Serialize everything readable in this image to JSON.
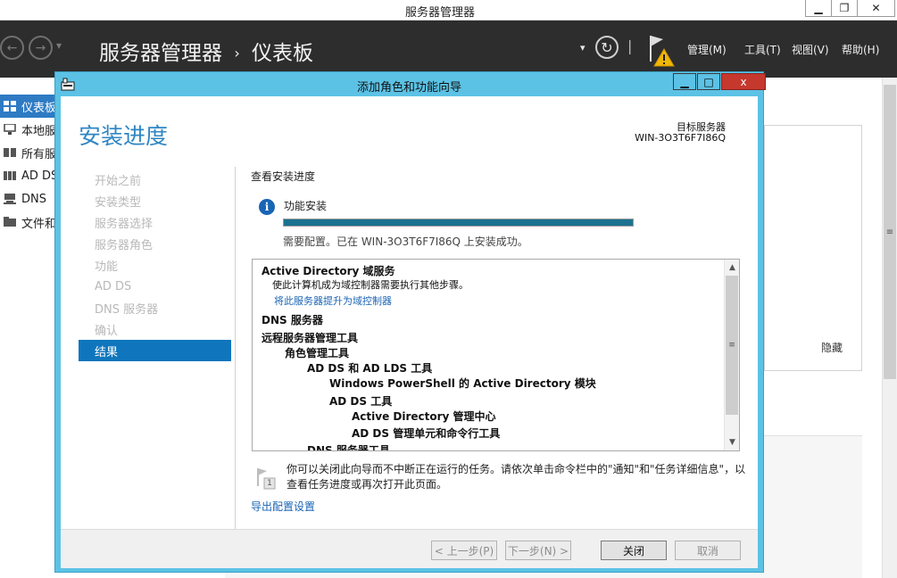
{
  "window": {
    "title": "服务器管理器",
    "minimize_glyph": "▁",
    "restore_glyph": "❐",
    "close_glyph": "✕"
  },
  "header": {
    "breadcrumb_app": "服务器管理器",
    "breadcrumb_sep": "›",
    "breadcrumb_page": "仪表板",
    "back_glyph": "←",
    "forward_glyph": "→",
    "dropdown_glyph": "▾",
    "refresh_glyph": "↻",
    "separator": "|",
    "menus": [
      {
        "label": "管理(M)"
      },
      {
        "label": "工具(T)"
      },
      {
        "label": "视图(V)"
      },
      {
        "label": "帮助(H)"
      }
    ]
  },
  "sidebar": {
    "items": [
      {
        "label": "仪表板",
        "icon": "dashboard-icon",
        "active": true
      },
      {
        "label": "本地服务器",
        "icon": "local-server-icon"
      },
      {
        "label": "所有服务器",
        "icon": "all-servers-icon"
      },
      {
        "label": "AD DS",
        "icon": "ad-ds-icon"
      },
      {
        "label": "DNS",
        "icon": "dns-icon"
      },
      {
        "label": "文件和存储服务",
        "icon": "file-storage-icon"
      }
    ]
  },
  "dashboard": {
    "hide_label": "隐藏",
    "scroll_grip": "≡"
  },
  "dialog": {
    "title": "添加角色和功能向导",
    "minimize_glyph": "▁",
    "maximize_glyph": "□",
    "close_glyph": "x",
    "heading": "安装进度",
    "target_label": "目标服务器",
    "target_value": "WIN-3O3T6F7I86Q",
    "steps": [
      {
        "label": "开始之前",
        "active": false
      },
      {
        "label": "安装类型",
        "active": false
      },
      {
        "label": "服务器选择",
        "active": false
      },
      {
        "label": "服务器角色",
        "active": false
      },
      {
        "label": "功能",
        "active": false
      },
      {
        "label": "AD DS",
        "active": false
      },
      {
        "label": "DNS 服务器",
        "active": false
      },
      {
        "label": "确认",
        "active": false
      },
      {
        "label": "结果",
        "active": true
      }
    ],
    "section_title": "查看安装进度",
    "info_glyph": "i",
    "feature_label": "功能安装",
    "progress": 1.0,
    "status_text": "需要配置。已在 WIN-3O3T6F7I86Q 上安装成功。",
    "results": [
      {
        "text": "Active Directory 域服务",
        "style": "bold",
        "level": 0
      },
      {
        "text": "使此计算机成为域控制器需要执行其他步骤。",
        "style": "small",
        "level": 0.5
      },
      {
        "text": "将此服务器提升为域控制器",
        "style": "link",
        "level": 0.5
      },
      {
        "text": "DNS 服务器",
        "style": "bold",
        "level": 0
      },
      {
        "text": "远程服务器管理工具",
        "style": "bold",
        "level": 0
      },
      {
        "text": "角色管理工具",
        "style": "bold",
        "level": 1
      },
      {
        "text": "AD DS 和 AD LDS 工具",
        "style": "bold",
        "level": 2
      },
      {
        "text": "Windows PowerShell 的 Active Directory 模块",
        "style": "bold",
        "level": 3
      },
      {
        "text": "AD DS 工具",
        "style": "bold",
        "level": 3
      },
      {
        "text": "Active Directory 管理中心",
        "style": "bold",
        "level": 4
      },
      {
        "text": "AD DS 管理单元和命令行工具",
        "style": "bold",
        "level": 4
      },
      {
        "text": "DNS 服务器工具",
        "style": "bold",
        "level": 2
      }
    ],
    "results_scroll_up": "▲",
    "results_scroll_down": "▼",
    "results_grip": "≡",
    "note_badge": "1",
    "note_text": "你可以关闭此向导而不中断正在运行的任务。请依次单击命令栏中的\"通知\"和\"任务详细信息\"，以查看任务进度或再次打开此页面。",
    "export_link": "导出配置设置",
    "buttons": {
      "prev": "< 上一步(P)",
      "next": "下一步(N) >",
      "close": "关闭",
      "cancel": "取消"
    }
  },
  "colors": {
    "dialog_chrome": "#5cc2e5",
    "header_bg": "#2d2d2e",
    "accent": "#0f76bd",
    "heading": "#2f86c3",
    "progress_fill": "#1a7290",
    "link": "#1a64b4",
    "close_red": "#c5382e"
  }
}
